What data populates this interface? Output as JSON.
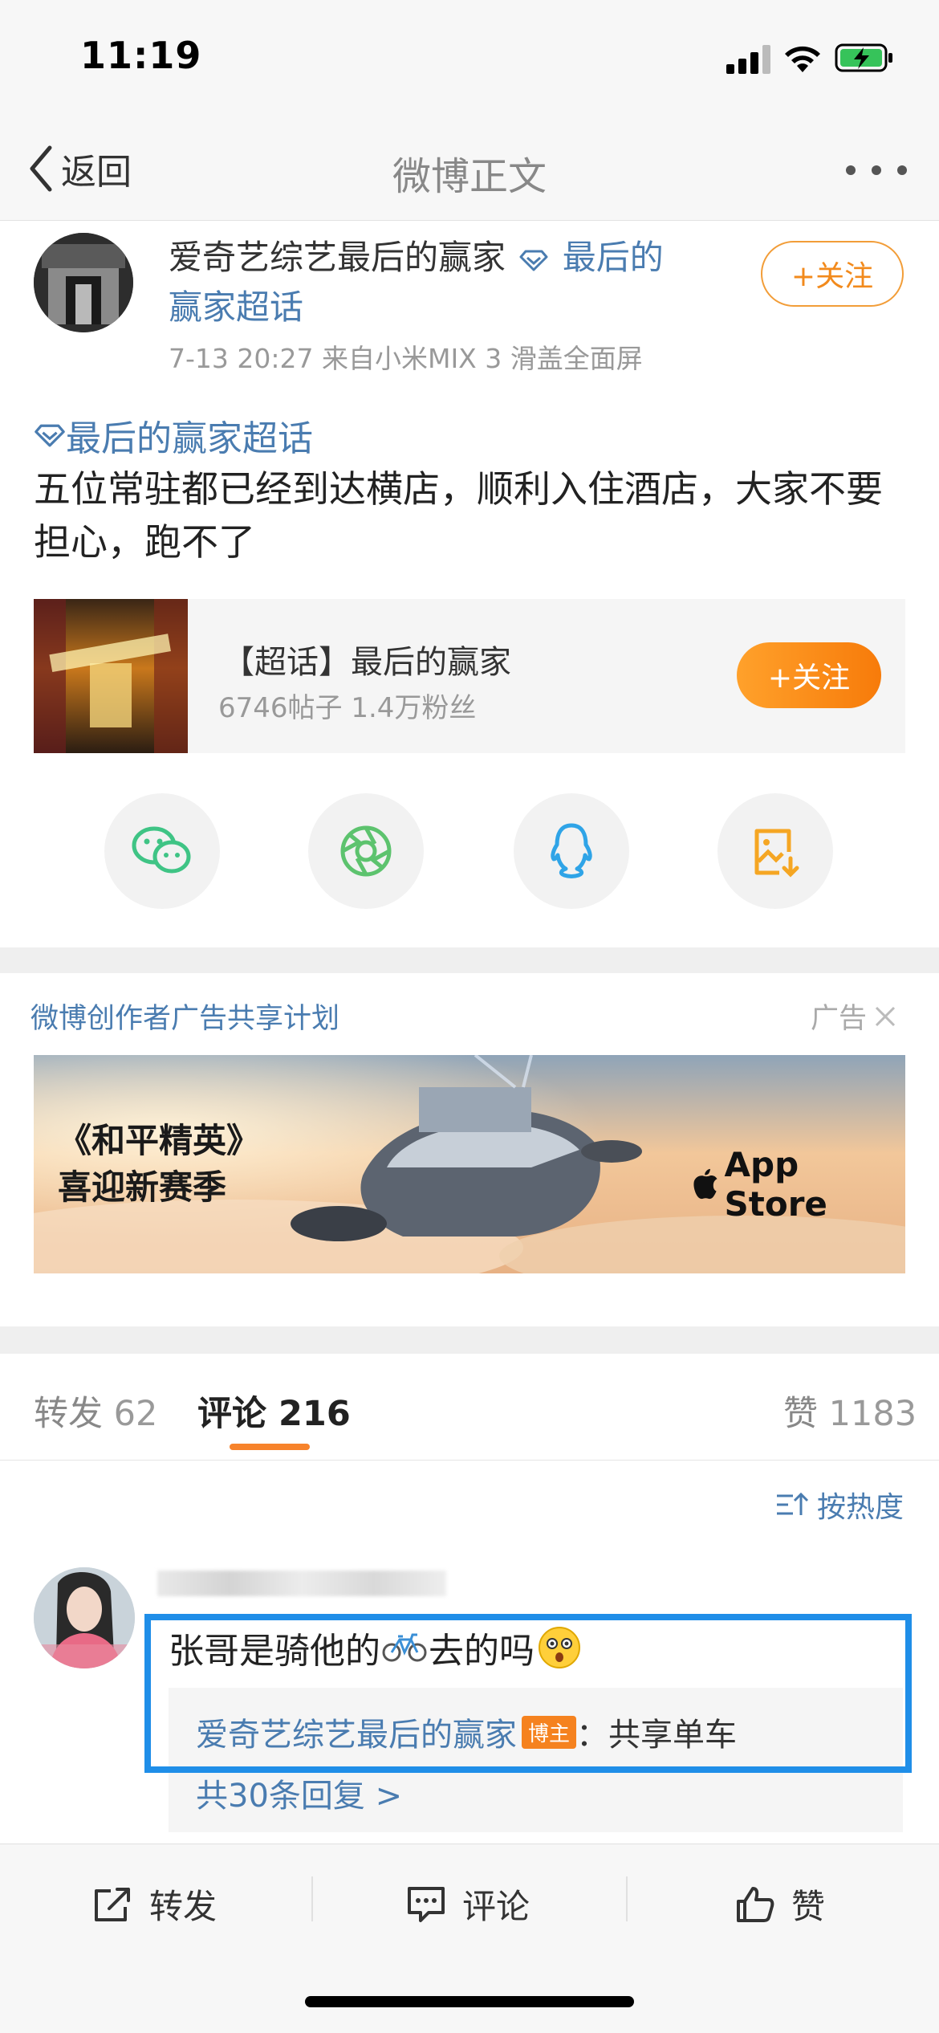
{
  "status_bar": {
    "time": "11:19"
  },
  "nav": {
    "back_label": "返回",
    "title": "微博正文"
  },
  "post": {
    "author_name": "爱奇艺综艺最后的赢家",
    "author_topic_line1": "最后的",
    "author_topic_line2": "赢家超话",
    "follow_label": "+关注",
    "meta": "7-13 20:27  来自小米MIX 3 滑盖全面屏",
    "topic": "最后的赢家超话",
    "body": "五位常驻都已经到达横店，顺利入住酒店，大家不要担心，跑不了"
  },
  "topic_card": {
    "title": "【超话】最后的赢家",
    "stats": "6746帖子  1.4万粉丝",
    "follow_label": "+关注"
  },
  "share": {
    "items": [
      {
        "icon": "wechat-icon"
      },
      {
        "icon": "moments-icon"
      },
      {
        "icon": "qq-icon"
      },
      {
        "icon": "save-image-icon"
      }
    ]
  },
  "ad": {
    "label": "微博创作者广告共享计划",
    "tag": "广告",
    "banner_line1": "《和平精英》",
    "banner_line2": "喜迎新赛季",
    "store": "App Store"
  },
  "tabs": {
    "repost_label": "转发",
    "repost_count": "62",
    "comment_label": "评论",
    "comment_count": "216",
    "like_label": "赞",
    "like_count": "1183",
    "sort_label": "按热度"
  },
  "comment": {
    "text_before": "张哥是骑他的",
    "text_after": "去的吗",
    "reply_author": "爱奇艺综艺最后的赢家",
    "reply_badge": "博主",
    "reply_text": "：共享单车",
    "more_replies": "共30条回复 >"
  },
  "toolbar": {
    "repost": "转发",
    "comment": "评论",
    "like": "赞"
  },
  "colors": {
    "link": "#4a7cb0",
    "accent": "#f7832b",
    "highlight": "#1f8ee8"
  }
}
